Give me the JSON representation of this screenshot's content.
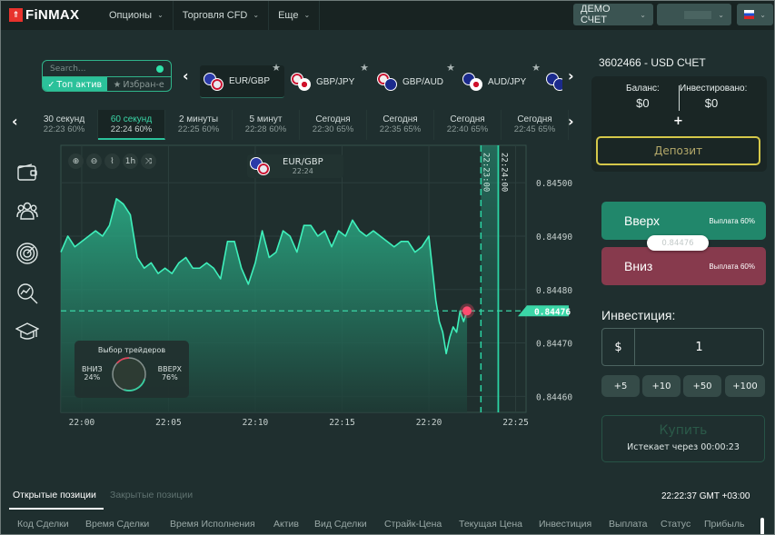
{
  "header": {
    "logo": "FiNMAX",
    "nav": [
      {
        "label": "Опционы"
      },
      {
        "label": "Торговля CFD"
      },
      {
        "label": "Еще"
      }
    ],
    "account_mode": "ДЕМО СЧЕТ",
    "account_select_value": "",
    "language_flag": "ru-flag"
  },
  "sidebar": {
    "icons": [
      "wallet-icon",
      "users-icon",
      "radar-icon",
      "analytics-icon",
      "education-icon"
    ]
  },
  "search": {
    "placeholder": "Search...",
    "tabs": [
      {
        "label": "Топ актив",
        "active": true
      },
      {
        "label": "Избран-е",
        "active": false
      }
    ]
  },
  "assets": [
    {
      "pair": "EUR/GBP",
      "active": true
    },
    {
      "pair": "GBP/JPY",
      "active": false
    },
    {
      "pair": "GBP/AUD",
      "active": false
    },
    {
      "pair": "AUD/JPY",
      "active": false
    }
  ],
  "expiry_tabs": [
    {
      "label": "30 секунд",
      "sub": "22:23 60%",
      "active": false
    },
    {
      "label": "60 секунд",
      "sub": "22:24 60%",
      "active": true
    },
    {
      "label": "2 минуты",
      "sub": "22:25 60%",
      "active": false
    },
    {
      "label": "5 минут",
      "sub": "22:28 60%",
      "active": false
    },
    {
      "label": "Сегодня",
      "sub": "22:30 65%",
      "active": false
    },
    {
      "label": "Сегодня",
      "sub": "22:35 65%",
      "active": false
    },
    {
      "label": "Сегодня",
      "sub": "22:40 65%",
      "active": false
    },
    {
      "label": "Сегодня",
      "sub": "22:45 65%",
      "active": false
    }
  ],
  "chart": {
    "tools": [
      "zoom-in-icon",
      "zoom-out-icon",
      "chart-type-icon",
      "1h",
      "indicator-icon"
    ],
    "pair": "EUR/GBP",
    "expiry": "22:24",
    "current_price": "0.84476",
    "purchase_deadline_label": "22:23:00",
    "expiry_line_label": "22:24:00",
    "traders": {
      "title": "Выбор трейдеров",
      "down_label": "ВНИЗ",
      "down_pct": "24%",
      "up_label": "ВВЕРХ",
      "up_pct": "76%",
      "down_value": 24,
      "up_value": 76
    }
  },
  "chart_data": {
    "type": "area",
    "title": "EUR/GBP",
    "xlabel": "",
    "ylabel": "",
    "x_ticks": [
      "22:00",
      "22:05",
      "22:10",
      "22:15",
      "22:20",
      "22:25"
    ],
    "y_ticks": [
      "0.84500",
      "0.84490",
      "0.84480",
      "0.84470",
      "0.84460"
    ],
    "ylim": [
      0.84457,
      0.84507
    ],
    "xlim_minutes": [
      -1.2,
      25.6
    ],
    "grid": true,
    "series": [
      {
        "name": "EUR/GBP",
        "x_minutes": [
          -1.2,
          -0.8,
          -0.4,
          0,
          0.4,
          0.8,
          1.2,
          1.6,
          2.0,
          2.4,
          2.8,
          3.2,
          3.6,
          4.0,
          4.4,
          4.8,
          5.2,
          5.6,
          6.0,
          6.4,
          6.8,
          7.2,
          7.6,
          8.0,
          8.4,
          8.8,
          9.2,
          9.6,
          10.0,
          10.4,
          10.8,
          11.2,
          11.6,
          12.0,
          12.4,
          12.8,
          13.2,
          13.6,
          14.0,
          14.4,
          14.8,
          15.2,
          15.6,
          16.0,
          16.4,
          16.8,
          17.2,
          17.6,
          18.0,
          18.4,
          18.8,
          19.2,
          19.6,
          20.0,
          20.4,
          20.6,
          20.8,
          21.0,
          21.2,
          21.4,
          21.6,
          21.8,
          22.0,
          22.2
        ],
        "values": [
          0.84487,
          0.8449,
          0.84488,
          0.84489,
          0.8449,
          0.84491,
          0.8449,
          0.84492,
          0.84497,
          0.84496,
          0.84494,
          0.84486,
          0.84484,
          0.84485,
          0.84483,
          0.84484,
          0.84483,
          0.84485,
          0.84486,
          0.84484,
          0.84484,
          0.84485,
          0.84484,
          0.84482,
          0.84489,
          0.84489,
          0.84484,
          0.84481,
          0.84485,
          0.84491,
          0.84486,
          0.84487,
          0.84491,
          0.8449,
          0.84487,
          0.84492,
          0.84492,
          0.8449,
          0.84491,
          0.84488,
          0.84491,
          0.8449,
          0.84493,
          0.84491,
          0.8449,
          0.84491,
          0.8449,
          0.84489,
          0.84488,
          0.84489,
          0.84489,
          0.84487,
          0.84488,
          0.8449,
          0.84478,
          0.84474,
          0.84472,
          0.84468,
          0.84471,
          0.84473,
          0.84472,
          0.84476,
          0.84474,
          0.84476
        ]
      }
    ],
    "current_value": 0.84476
  },
  "account": {
    "id_label": "3602466 - USD СЧЕТ",
    "balance_label": "Баланс:",
    "balance_value": "$0",
    "invested_label": "Инвестировано:",
    "invested_value": "$0",
    "add_symbol": "+",
    "deposit_label": "Депозит"
  },
  "trade": {
    "up_label": "Вверх",
    "up_payout": "Выплата 60%",
    "down_label": "Вниз",
    "down_payout": "Выплата 60%",
    "price_pill": "0.84476",
    "investment_label": "Инвестиция:",
    "currency_symbol": "$",
    "amount": "1",
    "increments": [
      "+5",
      "+10",
      "+50",
      "+100"
    ],
    "buy_label": "Купить",
    "expires_label": "Истекает через  00:00:23",
    "colors": {
      "up": "#21876b",
      "down": "#873a4d",
      "accent": "#2bc19a"
    }
  },
  "positions": {
    "tabs": [
      {
        "label": "Открытые позиции",
        "active": true
      },
      {
        "label": "Закрытые позиции",
        "active": false
      }
    ],
    "clock": "22:22:37 GMT +03:00",
    "columns": [
      "Код Сделки",
      "Время Сделки",
      "Время Исполнения",
      "Актив",
      "Вид Сделки",
      "Страйк-Цена",
      "Текущая Цена",
      "Инвестиция",
      "Выплата",
      "Статус",
      "Прибыль"
    ]
  }
}
